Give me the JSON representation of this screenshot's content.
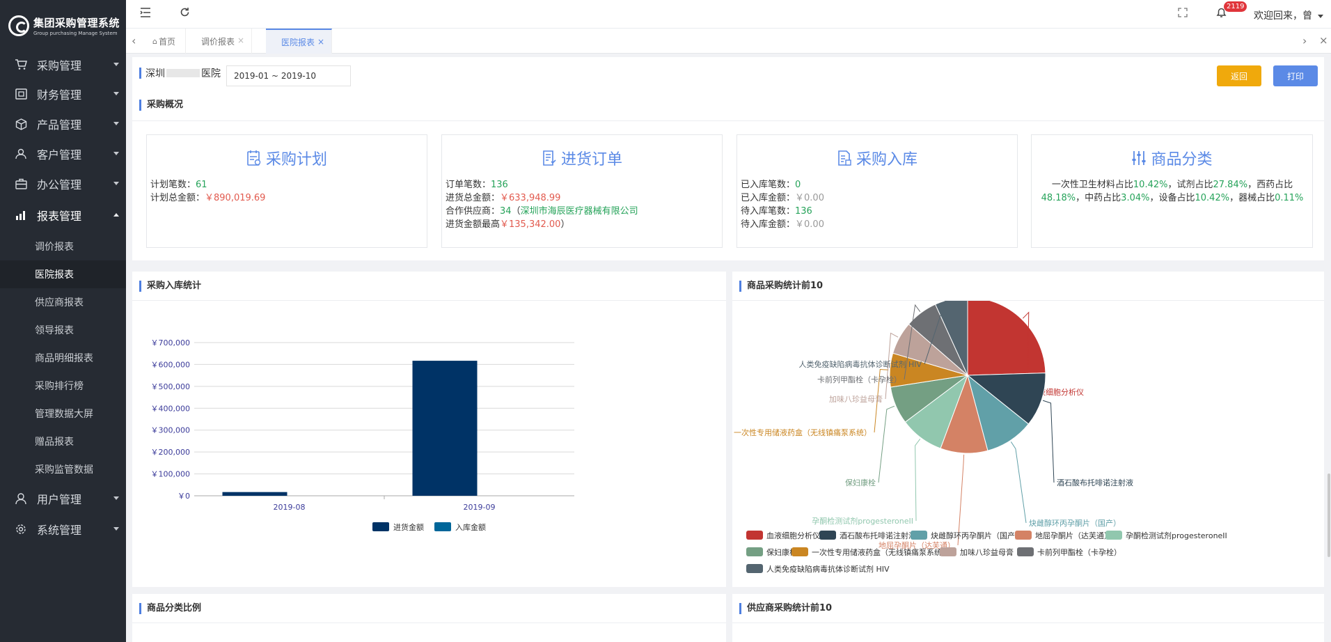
{
  "app": {
    "title": "集团采购管理系统",
    "subtitle": "Group purchasing Manage System"
  },
  "sidebar": {
    "menus": [
      {
        "label": "采购管理",
        "icon": "cart-icon"
      },
      {
        "label": "财务管理",
        "icon": "ledger-icon"
      },
      {
        "label": "产品管理",
        "icon": "box-icon"
      },
      {
        "label": "客户管理",
        "icon": "customer-icon"
      },
      {
        "label": "办公管理",
        "icon": "briefcase-icon"
      },
      {
        "label": "报表管理",
        "icon": "bar-chart-icon"
      }
    ],
    "submenu": [
      "调价报表",
      "医院报表",
      "供应商报表",
      "领导报表",
      "商品明细报表",
      "采购排行榜",
      "管理数据大屏",
      "赠品报表",
      "采购监管数据"
    ],
    "active_sub": "医院报表",
    "bottom_menus": [
      {
        "label": "用户管理",
        "icon": "user-icon"
      },
      {
        "label": "系统管理",
        "icon": "settings-icon"
      }
    ]
  },
  "topbar": {
    "notification_count": "2119",
    "welcome": "欢迎回来，曾"
  },
  "tabs": [
    {
      "label": "首页",
      "icon": "home-icon"
    },
    {
      "label": "调价报表"
    },
    {
      "label": "医院报表"
    }
  ],
  "filter": {
    "hospital_prefix": "深圳",
    "hospital_suffix": "医院",
    "date_range": "2019-01 ~ 2019-10",
    "back_label": "返回",
    "print_label": "打印"
  },
  "overview": {
    "title": "采购概况",
    "plan": {
      "title": "采购计划",
      "count_label": "计划笔数：",
      "count": "61",
      "amount_label": "计划总金额：",
      "amount": "￥890,019.69"
    },
    "order": {
      "title": "进货订单",
      "count_label": "订单笔数：",
      "count": "136",
      "amount_label": "进货总金额：",
      "amount": "￥633,948.99",
      "supplier_label": "合作供应商：",
      "supplier_count": "34",
      "supplier_open": "（",
      "supplier_name": "深圳市海辰医疗器械有限公司",
      "max_label": "进货金额最高",
      "max_amount": "￥135,342.00",
      "close": "）"
    },
    "storage": {
      "title": "采购入库",
      "in_count_label": "已入库笔数：",
      "in_count": "0",
      "in_amount_label": "已入库金额：",
      "in_amount": "￥0.00",
      "wait_count_label": "待入库笔数：",
      "wait_count": "136",
      "wait_amount_label": "待入库金额：",
      "wait_amount": "￥0.00"
    },
    "category": {
      "title": "商品分类",
      "line1": "一次性卫生材料占比10.42%，试剂占比27.84%，西药占比",
      "line2": "48.18%，中药占比3.04%，设备占比10.42%，器械占比0.11%"
    }
  },
  "panels": {
    "bar_title": "采购入库统计",
    "pie_title": "商品采购统计前10",
    "category_ratio_title": "商品分类比例",
    "supplier_title": "供应商采购统计前10"
  },
  "chart_data": [
    {
      "type": "bar",
      "categories": [
        "2019-08",
        "2019-09"
      ],
      "series": [
        {
          "name": "进货金额",
          "values": [
            17000,
            617000
          ],
          "color": "#003366"
        },
        {
          "name": "入库金额",
          "values": [
            0,
            0
          ],
          "color": "#006699"
        }
      ],
      "y_ticks": [
        "￥0",
        "￥100,000",
        "￥200,000",
        "￥300,000",
        "￥400,000",
        "￥500,000",
        "￥600,000",
        "￥700,000"
      ],
      "ylim": [
        0,
        700000
      ],
      "grid": true,
      "legend": "bottom"
    },
    {
      "type": "pie",
      "slices": [
        {
          "name": "血液细胞分析仪",
          "value": 24.5,
          "color": "#c23531"
        },
        {
          "name": "酒石酸布托啡诺注射液",
          "value": 11.2,
          "color": "#2f4554"
        },
        {
          "name": "炔雌醇环丙孕酮片（国产）",
          "value": 10.1,
          "color": "#61a0a8"
        },
        {
          "name": "地屈孕酮片（达芙通）",
          "value": 9.8,
          "color": "#d48265"
        },
        {
          "name": "孕酮检测试剂progesteroneII",
          "value": 9.1,
          "color": "#91c7ae"
        },
        {
          "name": "保妇康栓",
          "value": 7.8,
          "color": "#749f83"
        },
        {
          "name": "一次性专用储液药盒（无线镇痛泵系统）",
          "value": 7.0,
          "color": "#ca8622"
        },
        {
          "name": "加味八珍益母膏",
          "value": 6.8,
          "color": "#bda29a"
        },
        {
          "name": "卡前列甲酯栓（卡孕栓）",
          "value": 6.8,
          "color": "#6e7074"
        },
        {
          "name": "人类免疫缺陷病毒抗体诊断试剂 HIV",
          "value": 6.8,
          "color": "#546570"
        }
      ],
      "legend": "bottom"
    }
  ]
}
